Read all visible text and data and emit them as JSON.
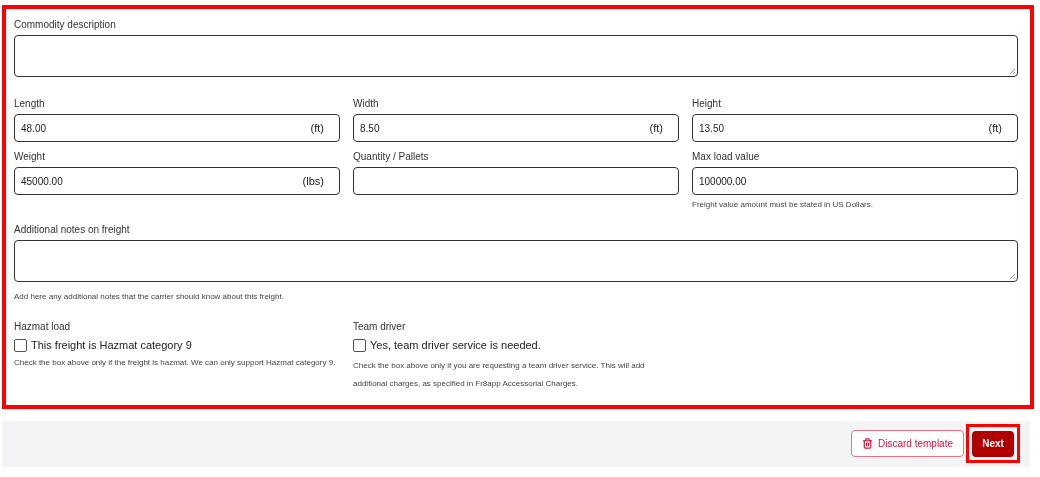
{
  "form": {
    "highlighted": true,
    "description": {
      "label": "Commodity description"
    },
    "measurements": [
      {
        "label": "Length",
        "value": "48.00",
        "unit": "(ft)"
      },
      {
        "label": "Width",
        "value": "8.50",
        "unit": "(ft)"
      },
      {
        "label": "Height",
        "value": "13.50",
        "unit": "(ft)"
      },
      {
        "label": "Weight",
        "value": "45000.00",
        "unit": "(lbs)"
      },
      {
        "label": "Quantity / Pallets"
      },
      {
        "label": "Max load value",
        "value": "100000.00",
        "hint": "Freight value amount must be stated in US Dollars."
      }
    ],
    "notes": {
      "label": "Additional notes on freight",
      "hint": "Add here any additional notes that the carrier should know about this freight."
    },
    "options": [
      {
        "label": "Hazmat load",
        "checkbox_label": "This freight is Hazmat category 9",
        "checked": false,
        "hint": "Check the box above only if the freight is hazmat. We can only support Hazmat category 9."
      },
      {
        "label": "Team driver",
        "checkbox_label": "Yes, team driver service is needed.",
        "checked": false,
        "hint": "Check the box above only if you are requesting a team driver service. This will add additional charges, as specified in Fr8app Accessorial Charges."
      }
    ]
  },
  "footer": {
    "discard_button": "Discard template",
    "next_button": {
      "label": "Next",
      "highlighted": true
    }
  }
}
